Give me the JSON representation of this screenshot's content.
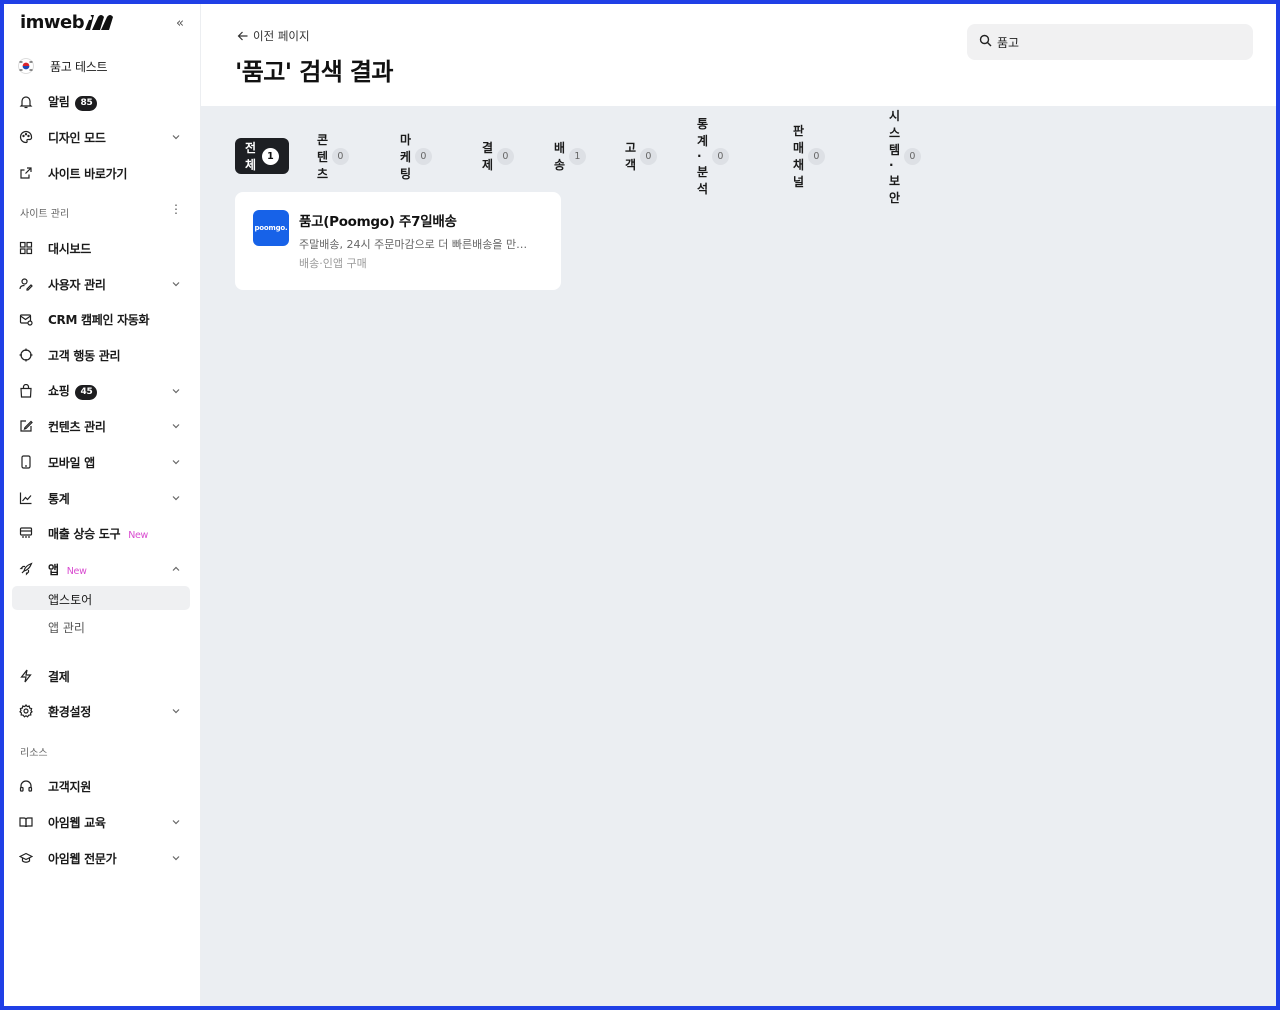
{
  "app": {
    "logo_text": "imweb"
  },
  "sidebar": {
    "site_name": "품고 테스트",
    "top_items": [
      {
        "label": "알림",
        "badge": "85"
      },
      {
        "label": "디자인 모드"
      },
      {
        "label": "사이트 바로가기"
      }
    ],
    "section_site": "사이트 관리",
    "items": [
      {
        "label": "대시보드"
      },
      {
        "label": "사용자 관리"
      },
      {
        "label": "CRM 캠페인 자동화"
      },
      {
        "label": "고객 행동 관리"
      },
      {
        "label": "쇼핑",
        "badge": "45"
      },
      {
        "label": "컨텐츠 관리"
      },
      {
        "label": "모바일 앱"
      },
      {
        "label": "통계"
      },
      {
        "label": "매출 상승 도구",
        "tag": "New"
      },
      {
        "label": "앱",
        "tag": "New"
      }
    ],
    "app_sub": [
      {
        "label": "앱스토어"
      },
      {
        "label": "앱 관리"
      }
    ],
    "bottom_items": [
      {
        "label": "결제"
      },
      {
        "label": "환경설정"
      }
    ],
    "section_resources": "리소스",
    "resource_items": [
      {
        "label": "고객지원"
      },
      {
        "label": "아임웹 교육"
      },
      {
        "label": "아임웹 전문가"
      }
    ]
  },
  "header": {
    "back_label": "이전 페이지",
    "title": "'품고' 검색 결과",
    "search_value": "품고"
  },
  "tabs": [
    {
      "label": "전체",
      "count": "1"
    },
    {
      "label": "콘텐츠",
      "count": "0"
    },
    {
      "label": "마케팅",
      "count": "0"
    },
    {
      "label": "결제",
      "count": "0"
    },
    {
      "label": "배송",
      "count": "1"
    },
    {
      "label": "고객",
      "count": "0"
    },
    {
      "label": "통계·분석",
      "count": "0"
    },
    {
      "label": "판매 채널",
      "count": "0"
    },
    {
      "label": "시스템·보안",
      "count": "0"
    }
  ],
  "results": [
    {
      "logo_text": "poomgo.",
      "title": "품고(Poomgo) 주7일배송",
      "description": "주말배송, 24시 주문마감으로 더 빠른배송을 만…",
      "tags": "배송·인앱 구매"
    }
  ],
  "colors": {
    "accent_frame": "#1f3fe6",
    "badge_dark": "#1d1d1f",
    "new_tag": "#d94bd0",
    "content_bg": "#ebeef2",
    "card_logo_bg": "#1762e8"
  }
}
